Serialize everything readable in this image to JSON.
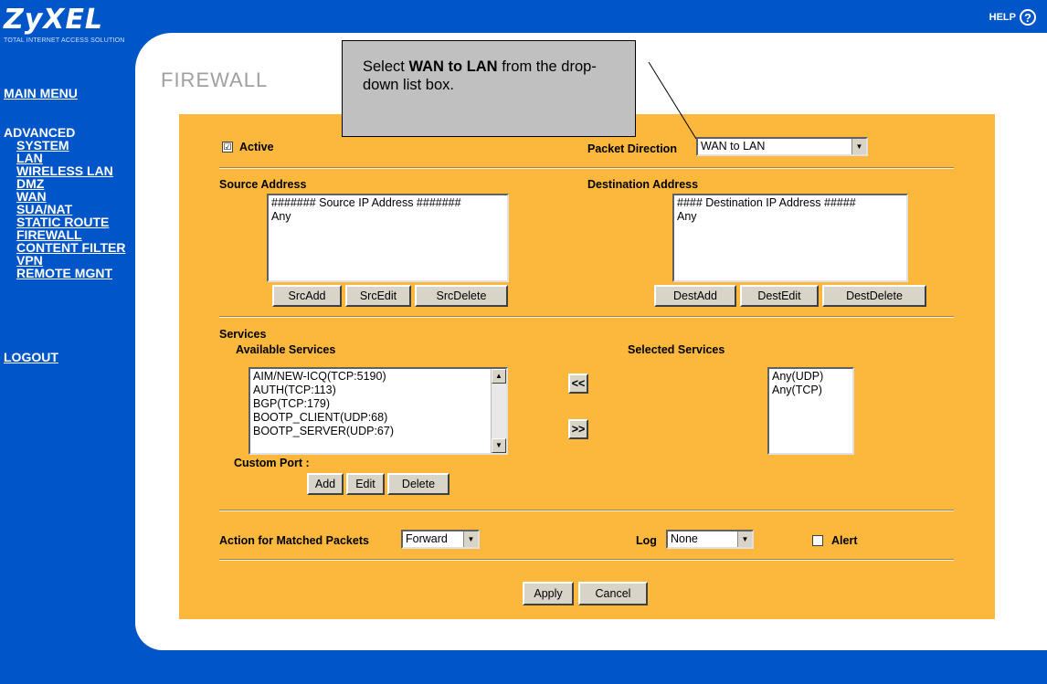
{
  "brand": {
    "logo": "ZyXEL",
    "tagline": "TOTAL INTERNET ACCESS SOLUTION"
  },
  "help": {
    "label": "HELP",
    "icon": "?"
  },
  "nav": {
    "main_menu": "MAIN MENU",
    "advanced": "ADVANCED",
    "items": [
      "SYSTEM",
      "LAN",
      "WIRELESS LAN",
      "DMZ",
      "WAN",
      "SUA/NAT",
      "STATIC ROUTE",
      "FIREWALL",
      "CONTENT FILTER",
      "VPN",
      "REMOTE MGNT"
    ],
    "logout": "LOGOUT"
  },
  "page": {
    "title": "FIREWALL"
  },
  "callout": {
    "prefix": "Select ",
    "bold": "WAN to LAN",
    "suffix": " from the drop-down list box."
  },
  "form": {
    "active_label": "Active",
    "active_checked": "☑",
    "packet_direction_label": "Packet Direction",
    "packet_direction_value": "WAN to LAN",
    "source_label": "Source Address",
    "source_items": [
      "####### Source IP Address #######",
      "Any"
    ],
    "src_add": "SrcAdd",
    "src_edit": "SrcEdit",
    "src_delete": "SrcDelete",
    "dest_label": "Destination Address",
    "dest_items": [
      "#### Destination IP Address #####",
      "Any"
    ],
    "dest_add": "DestAdd",
    "dest_edit": "DestEdit",
    "dest_delete": "DestDelete",
    "services_label": "Services",
    "available_label": "Available Services",
    "available_items": [
      "AIM/NEW-ICQ(TCP:5190)",
      "AUTH(TCP:113)",
      "BGP(TCP:179)",
      "BOOTP_CLIENT(UDP:68)",
      "BOOTP_SERVER(UDP:67)"
    ],
    "move_left": "<<",
    "move_right": ">>",
    "selected_label": "Selected Services",
    "selected_items": [
      "Any(UDP)",
      "Any(TCP)"
    ],
    "custom_port_label": "Custom Port :",
    "add": "Add",
    "edit": "Edit",
    "delete": "Delete",
    "action_label": "Action for Matched Packets",
    "action_value": "Forward",
    "log_label": "Log",
    "log_value": "None",
    "alert_label": "Alert",
    "apply": "Apply",
    "cancel": "Cancel"
  }
}
